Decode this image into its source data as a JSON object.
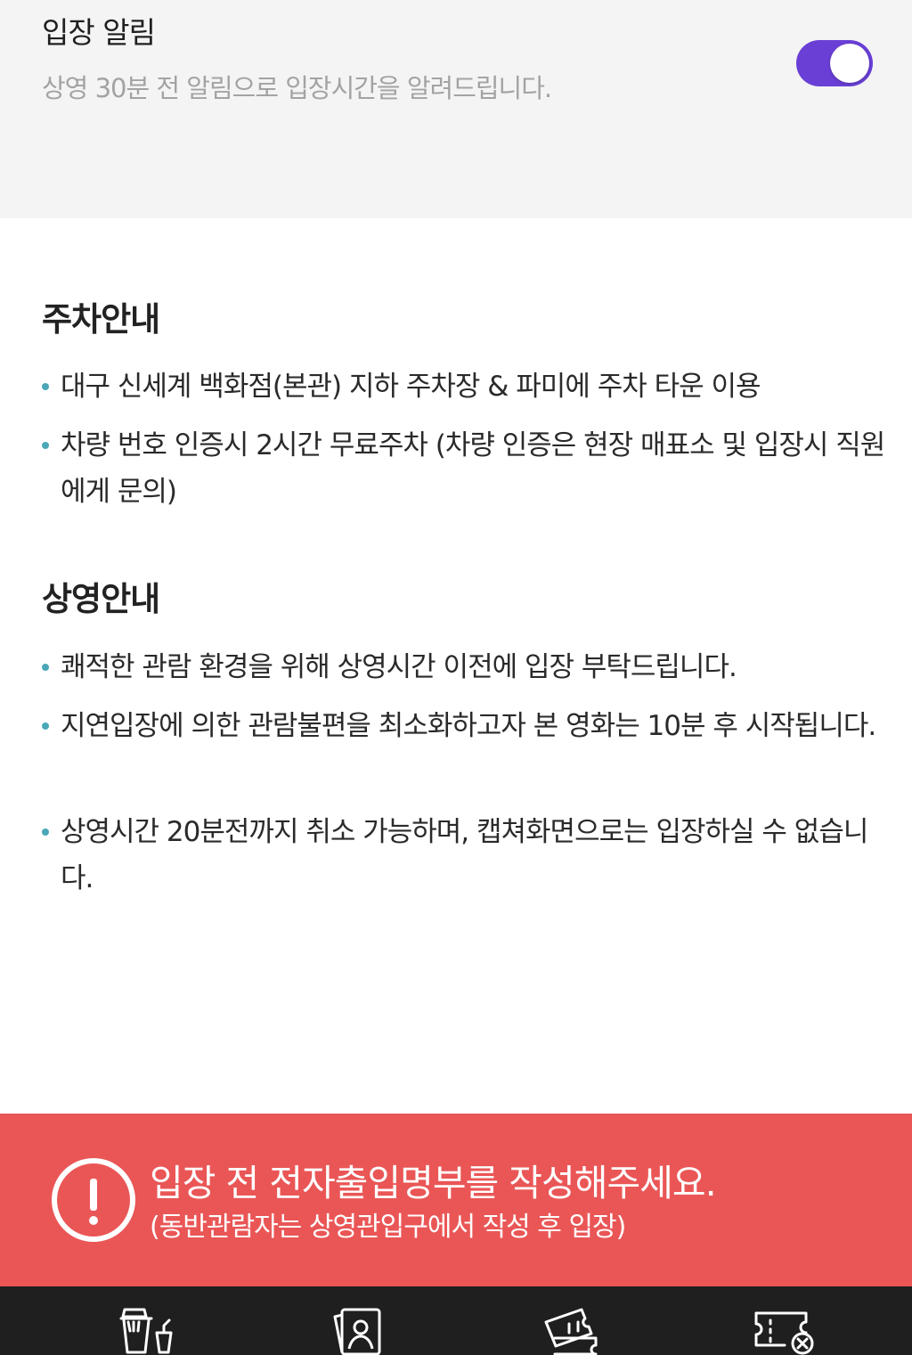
{
  "notification": {
    "title": "입장 알림",
    "description": "상영 30분 전 알림으로 입장시간을 알려드립니다.",
    "toggle_on": true,
    "toggle_color": "#6a3fd6"
  },
  "parking": {
    "title": "주차안내",
    "items": [
      "대구 신세계 백화점(본관) 지하 주차장 & 파미에 주차 타운 이용",
      "차량 번호 인증시 2시간 무료주차 (차량 인증은 현장 매표소 및 입장시 직원에게 문의)"
    ]
  },
  "screening": {
    "title": "상영안내",
    "items": [
      "쾌적한 관람 환경을 위해 상영시간 이전에 입장 부탁드립니다.",
      "지연입장에 의한 관람불편을 최소화하고자 본 영화는 10분 후 시작됩니다.",
      "상영시간 20분전까지 취소 가능하며, 캡쳐화면으로는 입장하실 수 없습니다."
    ]
  },
  "banner": {
    "main": "입장 전 전자출입명부를 작성해주세요.",
    "sub": "(동반관람자는 상영관입구에서 작성 후 입장)",
    "background": "#ea5656"
  },
  "bottom_nav": {
    "icons": [
      "snack-drink-icon",
      "photo-ticket-icon",
      "ticket-icon",
      "cancel-ticket-icon"
    ]
  }
}
